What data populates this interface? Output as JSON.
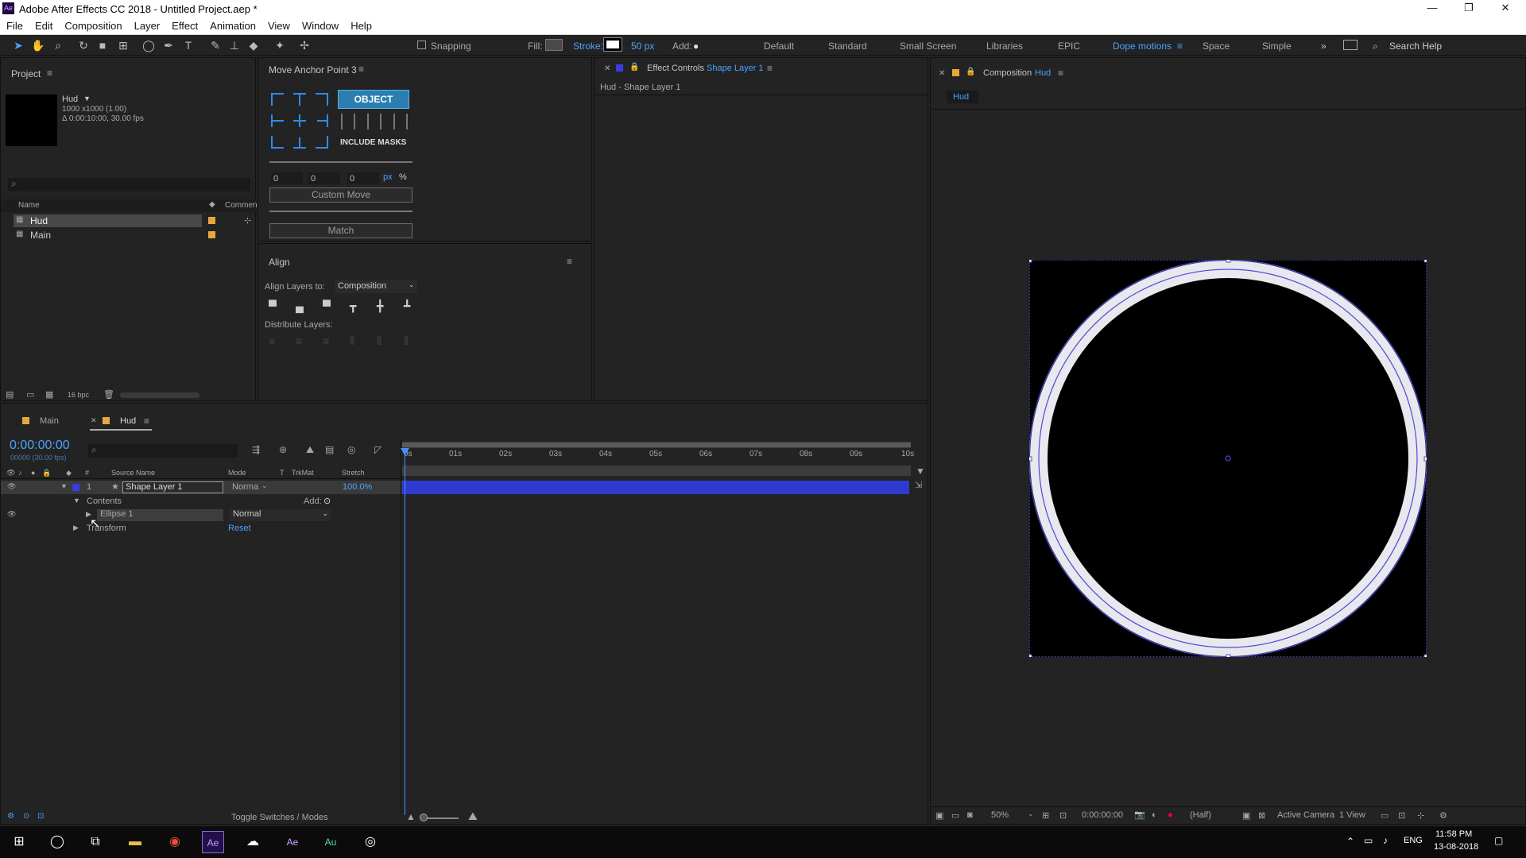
{
  "title": "Adobe After Effects CC 2018 - Untitled Project.aep *",
  "window_controls": {
    "minimize": "—",
    "maximize": "❐",
    "close": "✕"
  },
  "menu": [
    "File",
    "Edit",
    "Composition",
    "Layer",
    "Effect",
    "Animation",
    "View",
    "Window",
    "Help"
  ],
  "toolbar": {
    "snapping": "Snapping",
    "fill": "Fill:",
    "stroke": "Stroke:",
    "stroke_width": "50 px",
    "add": "Add:",
    "workspaces": [
      "Default",
      "Standard",
      "Small Screen",
      "Libraries",
      "EPIC",
      "Dope motions",
      "Space",
      "Simple"
    ],
    "active_workspace": "Dope motions",
    "more": "»",
    "search_placeholder": "Search Help"
  },
  "project": {
    "tab": "Project",
    "item_name": "Hud",
    "item_size": "1000 x1000 (1.00)",
    "item_duration": "Δ 0:00:10:00, 30.00 fps",
    "col_name": "Name",
    "col_comment": "Commen",
    "items": [
      "Hud",
      "Main"
    ],
    "bpc": "16 bpc"
  },
  "move_anchor": {
    "title": "Move Anchor Point 3",
    "object": "OBJECT",
    "include_masks": "INCLUDE MASKS",
    "x": "0",
    "y": "0",
    "z": "0",
    "px": "px",
    "pct": "%",
    "custom_move": "Custom Move",
    "match": "Match"
  },
  "align": {
    "title": "Align",
    "align_to_label": "Align Layers to:",
    "align_to_value": "Composition",
    "distribute": "Distribute Layers:"
  },
  "effect_controls": {
    "title": "Effect Controls",
    "layer": "Shape Layer 1",
    "path": "Hud - Shape Layer 1"
  },
  "composition": {
    "title": "Composition",
    "comp": "Hud",
    "tab": "Hud",
    "zoom": "50%",
    "timecode": "0:00:00:00",
    "resolution": "(Half)",
    "camera": "Active Camera",
    "views": "1 View"
  },
  "timeline": {
    "tabs": [
      "Main",
      "Hud"
    ],
    "timecode": "0:00:00:00",
    "fps": "00000 (30.00 fps)",
    "cols": {
      "num": "#",
      "source": "Source Name",
      "mode": "Mode",
      "t": "T",
      "trkmat": "TrkMat",
      "stretch": "Stretch"
    },
    "layer": {
      "num": "1",
      "name": "Shape Layer 1",
      "mode": "Norma",
      "stretch": "100.0%"
    },
    "contents": "Contents",
    "add": "Add:",
    "ellipse": "Ellipse 1",
    "ellipse_mode": "Normal",
    "transform": "Transform",
    "reset": "Reset",
    "ruler": [
      "0s",
      "01s",
      "02s",
      "03s",
      "04s",
      "05s",
      "06s",
      "07s",
      "08s",
      "09s",
      "10s"
    ],
    "toggle": "Toggle Switches / Modes"
  },
  "taskbar": {
    "lang": "ENG",
    "time": "11:58 PM",
    "date": "13-08-2018"
  }
}
